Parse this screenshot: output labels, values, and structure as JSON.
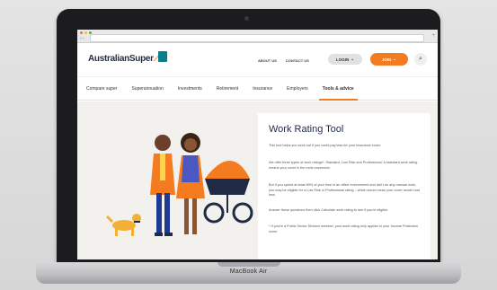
{
  "device": {
    "brand_label": "MacBook Air"
  },
  "browser": {
    "url": ""
  },
  "site": {
    "logo_text": "AustralianSuper",
    "top_links": [
      "ABOUT US",
      "CONTACT US"
    ],
    "login_label": "LOGIN",
    "join_label": "JOIN",
    "nav": [
      "Compare super",
      "Superannuation",
      "Investments",
      "Retirement",
      "Insurance",
      "Employers",
      "Tools & advice"
    ]
  },
  "card": {
    "title": "Work Rating Tool",
    "p1": "This tool helps you work out if you could pay less for your insurance cover.",
    "p2": "We offer three types of work ratings*: Standard, Low Risk and Professional. A standard work rating means your cover is the most expensive.",
    "p3": "But if you spend at least 80% of your time in an office environment and don't do any manual work, you may be eligible for a Low Risk or Professional rating – which would mean your cover would cost less.",
    "p4": "Answer these questions then click Calculate work rating to see if you're eligible.",
    "p5": "* If you're a Public Sector Division member, your work rating only applies to your Income Protection cover."
  },
  "colors": {
    "accent": "#f47b20",
    "navy": "#1f2a44",
    "teal": "#0a7e8c"
  }
}
